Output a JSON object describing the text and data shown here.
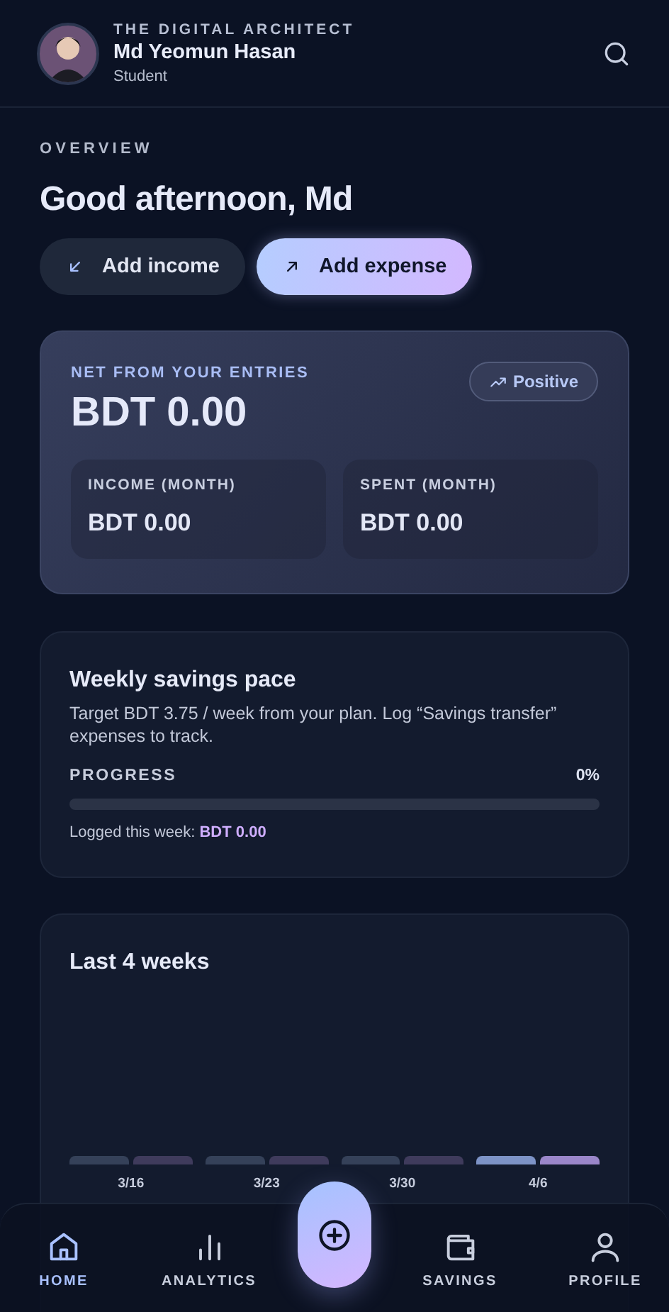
{
  "header": {
    "brand": "THE DIGITAL ARCHITECT",
    "name": "Md Yeomun Hasan",
    "role": "Student"
  },
  "overview": {
    "eyebrow": "OVERVIEW",
    "greeting": "Good afternoon, Md",
    "actions": [
      {
        "label": "Add income",
        "kind": "income"
      },
      {
        "label": "Add expense",
        "kind": "expense"
      }
    ]
  },
  "net_card": {
    "label": "NET FROM YOUR ENTRIES",
    "amount": "BDT 0.00",
    "badge": "Positive",
    "stats": [
      {
        "label": "INCOME (MONTH)",
        "value": "BDT 0.00"
      },
      {
        "label": "SPENT (MONTH)",
        "value": "BDT 0.00"
      }
    ]
  },
  "savings_card": {
    "title": "Weekly savings pace",
    "description": "Target BDT 3.75 / week from your plan. Log “Savings transfer” expenses to track.",
    "progress_label": "PROGRESS",
    "percent": "0%",
    "level": 0,
    "logged": "Logged this week: **BDT 0.00**"
  },
  "weeks_card": {
    "title": "Last 4 weeks",
    "weeks": [
      {
        "label": "3/16",
        "current": false
      },
      {
        "label": "3/23",
        "current": false
      },
      {
        "label": "3/30",
        "current": false
      },
      {
        "label": "4/6",
        "current": true
      }
    ]
  },
  "nav": [
    {
      "label": "HOME",
      "kind": "home",
      "selected": true
    },
    {
      "label": "ANALYTICS",
      "kind": "chart",
      "selected": false
    },
    {
      "kind": "add"
    },
    {
      "label": "SAVINGS",
      "kind": "wallet",
      "selected": false
    },
    {
      "label": "PROFILE",
      "kind": "person",
      "selected": false
    }
  ]
}
